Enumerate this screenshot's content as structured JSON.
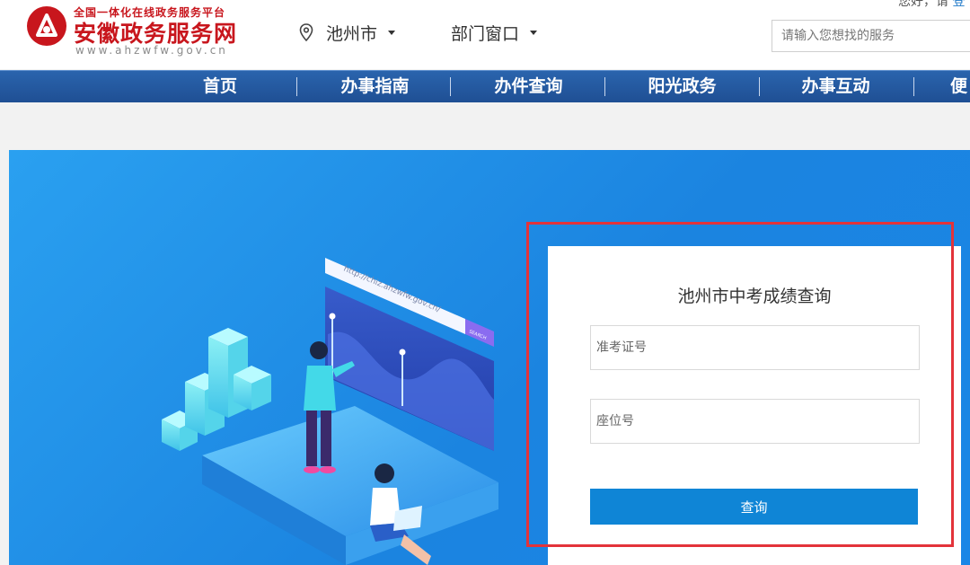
{
  "header": {
    "logo": {
      "slogan": "全国一体化在线政务服务平台",
      "name": "安徽政务服务网",
      "url": "www.ahzwfw.gov.cn"
    },
    "city_selector": {
      "label": "池州市",
      "icon": "location-pin-icon"
    },
    "dept_selector": {
      "label": "部门窗口"
    },
    "greeting": "您好，请",
    "login_label": "登",
    "search": {
      "placeholder": "请输入您想找的服务",
      "value": ""
    }
  },
  "nav": {
    "items": [
      {
        "label": "首页"
      },
      {
        "label": "办事指南"
      },
      {
        "label": "办件查询"
      },
      {
        "label": "阳光政务"
      },
      {
        "label": "办事互动"
      },
      {
        "label": "便"
      }
    ]
  },
  "hero": {
    "illustration": {
      "browser_url": "http://chiz.ahzwfw.gov.cn/",
      "search_button": "SEARCH"
    }
  },
  "query_card": {
    "title": "池州市中考成绩查询",
    "exam_no": {
      "placeholder": "准考证号",
      "value": ""
    },
    "seat_no": {
      "placeholder": "座位号",
      "value": ""
    },
    "submit_label": "查询"
  },
  "colors": {
    "brand_red": "#c8161d",
    "nav_blue": "#2a64ad",
    "hero_blue": "#1b84e0",
    "button_blue": "#0f85d6",
    "highlight_red": "#e3333a"
  }
}
